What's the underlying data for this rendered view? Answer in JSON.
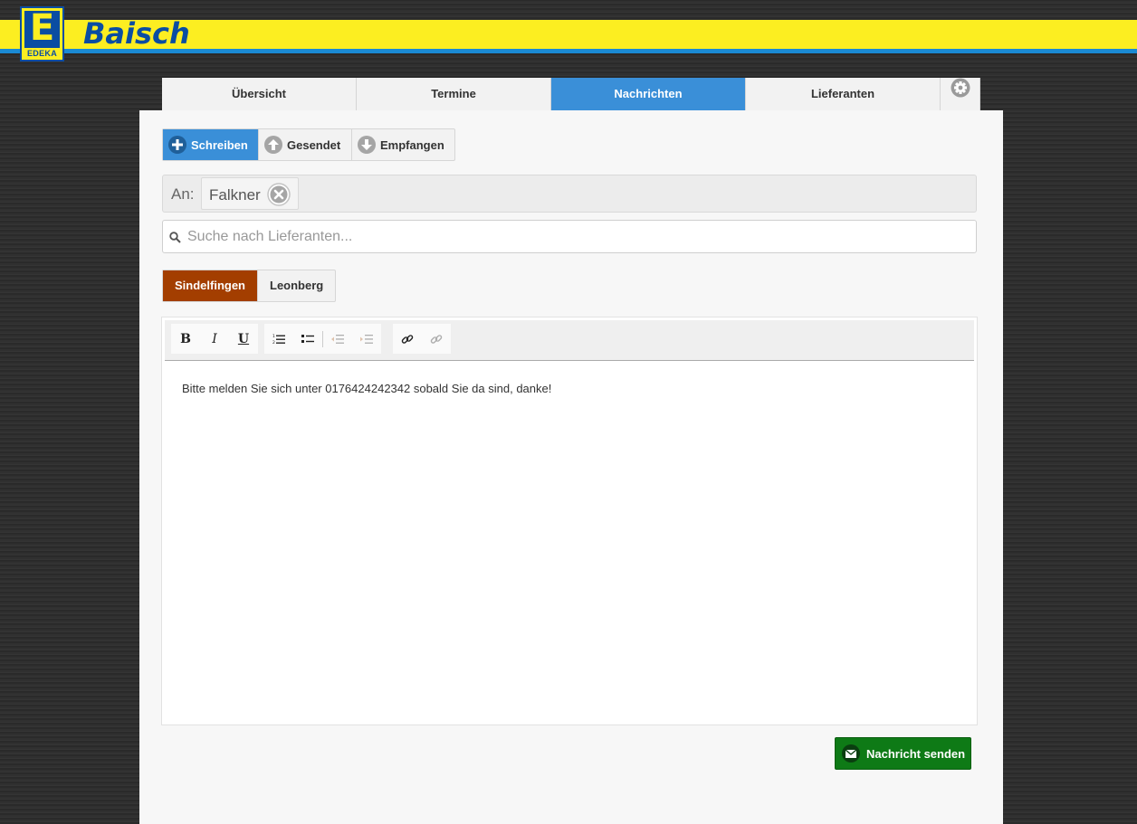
{
  "brand": {
    "logo_letter": "E",
    "logo_text": "EDEKA",
    "name": "Baisch",
    "colors": {
      "yellow": "#fcee21",
      "blue": "#0a4da2",
      "stripe": "#1a8ad4"
    }
  },
  "tabs": [
    {
      "label": "Übersicht",
      "active": false
    },
    {
      "label": "Termine",
      "active": false
    },
    {
      "label": "Nachrichten",
      "active": true
    },
    {
      "label": "Lieferanten",
      "active": false
    }
  ],
  "settings_icon": "gear-icon",
  "mode_buttons": [
    {
      "label": "Schreiben",
      "icon": "plus-icon",
      "active": true
    },
    {
      "label": "Gesendet",
      "icon": "arrow-up-icon",
      "active": false
    },
    {
      "label": "Empfangen",
      "icon": "arrow-down-icon",
      "active": false
    }
  ],
  "recipient": {
    "label": "An:",
    "chips": [
      {
        "name": "Falkner",
        "remove_icon": "close-circle-icon"
      }
    ]
  },
  "search": {
    "placeholder": "Suche nach Lieferanten...",
    "value": ""
  },
  "locations": [
    {
      "label": "Sindelfingen",
      "active": true,
      "color": "#a33e00"
    },
    {
      "label": "Leonberg",
      "active": false
    }
  ],
  "editor": {
    "toolbar": {
      "bold": "B",
      "italic": "I",
      "underline": "U",
      "icons": [
        "ordered-list-icon",
        "bullet-list-icon",
        "outdent-icon",
        "indent-icon",
        "link-icon",
        "unlink-icon"
      ]
    },
    "content": "Bitte melden Sie sich unter 0176424242342 sobald Sie da sind, danke!"
  },
  "send_button": {
    "label": "Nachricht senden",
    "icon": "envelope-icon",
    "color": "#0e7a16"
  }
}
